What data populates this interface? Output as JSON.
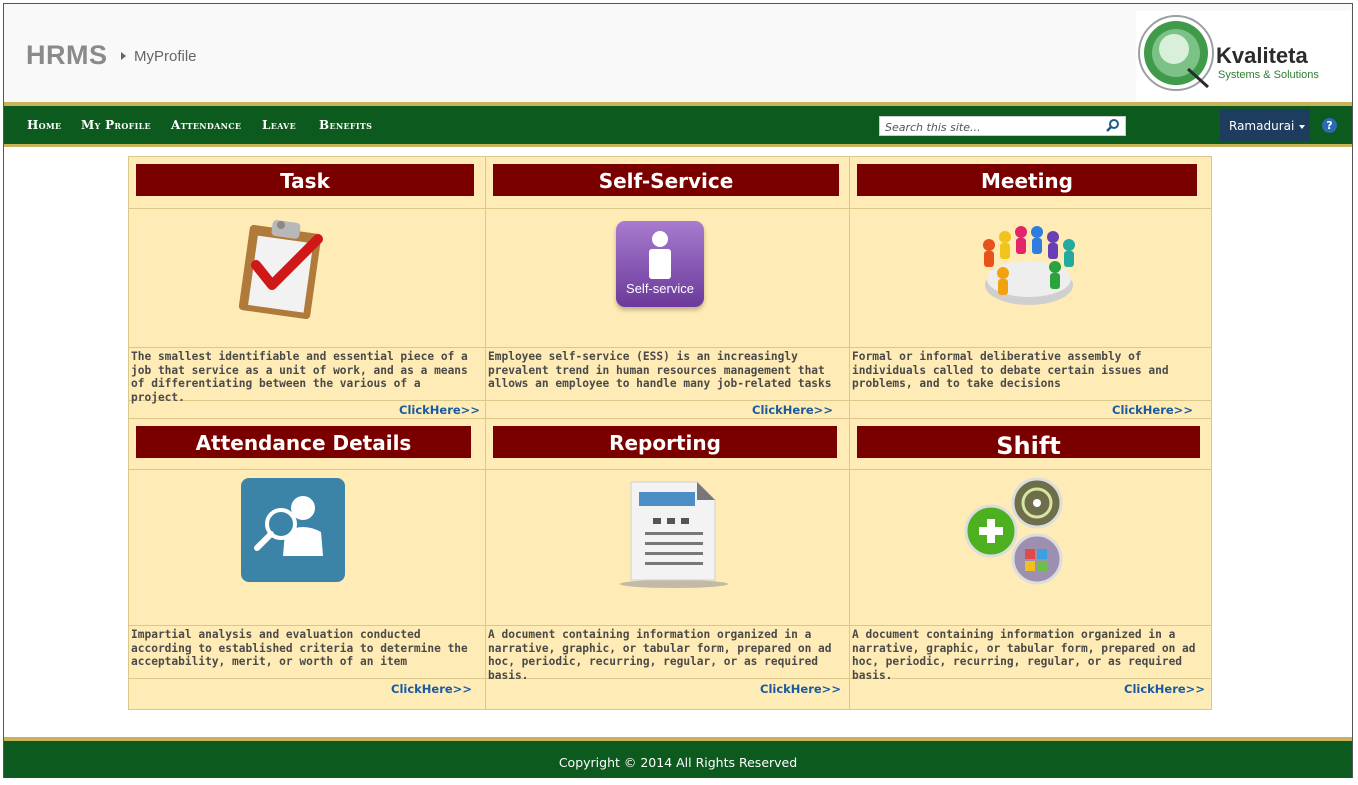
{
  "header": {
    "app_title": "HRMS",
    "breadcrumb": "MyProfile",
    "logo_name": "Kvaliteta",
    "logo_tagline": "Systems & Solutions"
  },
  "nav": {
    "items": [
      {
        "label": "Home"
      },
      {
        "label": "My Profile"
      },
      {
        "label": "Attendance"
      },
      {
        "label": "Leave"
      },
      {
        "label": "Benefits"
      }
    ],
    "search_placeholder": "Search this site...",
    "user_name": "Ramadurai",
    "help_label": "?"
  },
  "cards": [
    {
      "title": "Task",
      "icon": "clipboard-check-icon",
      "description": "The smallest identifiable and essential piece of a job that service as a unit of work, and as a means of differentiating between the various  of a project.",
      "link": "ClickHere>>"
    },
    {
      "title": "Self-Service",
      "icon": "self-service-icon",
      "icon_text": "Self-service",
      "description": "Employee self-service (ESS) is an increasingly prevalent trend in human resources management that allows an employee to handle many job-related tasks",
      "link": "ClickHere>>"
    },
    {
      "title": "Meeting",
      "icon": "meeting-table-icon",
      "description": "Formal or informal deliberative assembly of individuals called to debate certain issues and problems, and to take decisions",
      "link": "ClickHere>>"
    },
    {
      "title": "Attendance Details",
      "icon": "user-search-icon",
      "description": "Impartial analysis and evaluation conducted according to established criteria to determine the acceptability, merit, or worth of an item",
      "link": "ClickHere>>"
    },
    {
      "title": "Reporting",
      "icon": "document-report-icon",
      "description": "A document containing information organized in a narrative, graphic, or tabular form, prepared on ad hoc, periodic, recurring, regular, or as required basis.",
      "link": "ClickHere>>"
    },
    {
      "title": "Shift",
      "icon": "shift-circles-icon",
      "description": "A document containing information organized in a narrative, graphic, or tabular form, prepared on ad hoc, periodic, recurring, regular, or as required basis.",
      "link": "ClickHere>>"
    }
  ],
  "footer": {
    "copyright": "Copyright © 2014 All Rights Reserved"
  },
  "colors": {
    "nav_green": "#0d5a1e",
    "accent_gold": "#c8b35a",
    "card_bg": "#ffebb5",
    "title_red": "#7a0000",
    "link_blue": "#1a5ba0"
  }
}
